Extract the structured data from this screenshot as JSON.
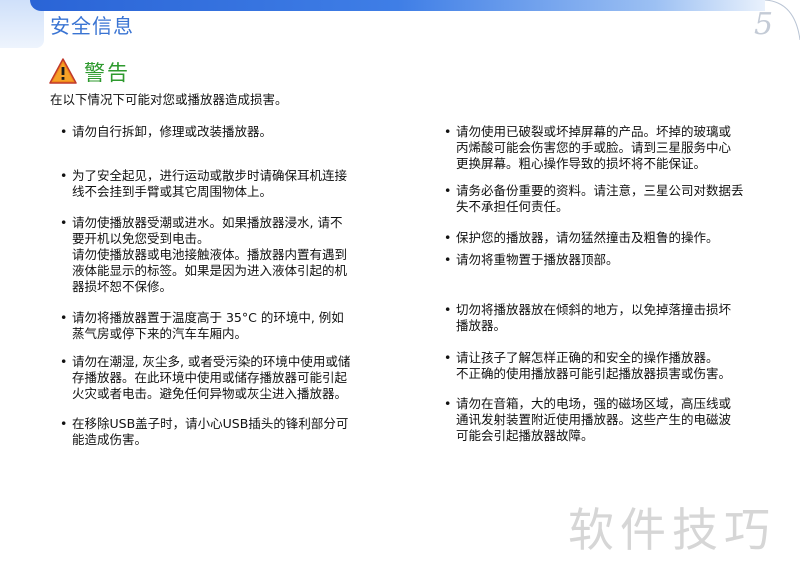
{
  "header": {
    "title": "安全信息",
    "page_number": "5"
  },
  "warning": {
    "icon": "warning-triangle-icon",
    "title": "警告"
  },
  "intro": "在以下情况下可能对您或播放器造成损害。",
  "left_items": [
    {
      "bullet": "•",
      "text": "请勿自行拆卸，修理或改装播放器。"
    },
    {
      "bullet": "•",
      "text": "为了安全起见，进行运动或散步时请确保耳机连接\n线不会挂到手臂或其它周围物体上。"
    },
    {
      "bullet": "•",
      "text": "请勿使播放器受潮或进水。如果播放器浸水, 请不\n要开机以免您受到电击。\n请勿使播放器或电池接触液体。播放器内置有遇到\n液体能显示的标签。如果是因为进入液体引起的机\n器损坏恕不保修。"
    },
    {
      "bullet": "•",
      "text": "请勿将播放器置于温度高于 35°C 的环境中, 例如\n蒸气房或停下来的汽车车厢内。"
    },
    {
      "bullet": "•",
      "text": "请勿在潮湿, 灰尘多, 或者受污染的环境中使用或储\n存播放器。在此环境中使用或储存播放器可能引起\n火灾或者电击。避免任何异物或灰尘进入播放器。"
    },
    {
      "bullet": "•",
      "text": "在移除USB盖子时，请小心USB插头的锋利部分可\n能造成伤害。"
    }
  ],
  "right_items": [
    {
      "bullet": "•",
      "text": "请勿使用已破裂或坏掉屏幕的产品。坏掉的玻璃或\n丙烯酸可能会伤害您的手或脸。请到三星服务中心\n更换屏幕。粗心操作导致的损坏将不能保证。"
    },
    {
      "bullet": "•",
      "text": "请务必备份重要的资料。请注意，三星公司对数据丢\n失不承担任何责任。"
    },
    {
      "bullet": "•",
      "text": "保护您的播放器，请勿猛然撞击及粗鲁的操作。"
    },
    {
      "bullet": "•",
      "text": "请勿将重物置于播放器顶部。"
    },
    {
      "bullet": "•",
      "text": "切勿将播放器放在倾斜的地方，以免掉落撞击损坏\n播放器。"
    },
    {
      "bullet": "•",
      "text": "请让孩子了解怎样正确的和安全的操作播放器。\n不正确的使用播放器可能引起播放器损害或伤害。"
    },
    {
      "bullet": "•",
      "text": "请勿在音箱，大的电场，强的磁场区域，高压线或\n通讯发射装置附近使用播放器。这些产生的电磁波\n可能会引起播放器故障。"
    }
  ],
  "watermark": "软件技巧",
  "colors": {
    "accent_blue": "#3a74d3",
    "warning_green": "#2e9a2e",
    "warning_orange": "#f08a1c"
  }
}
